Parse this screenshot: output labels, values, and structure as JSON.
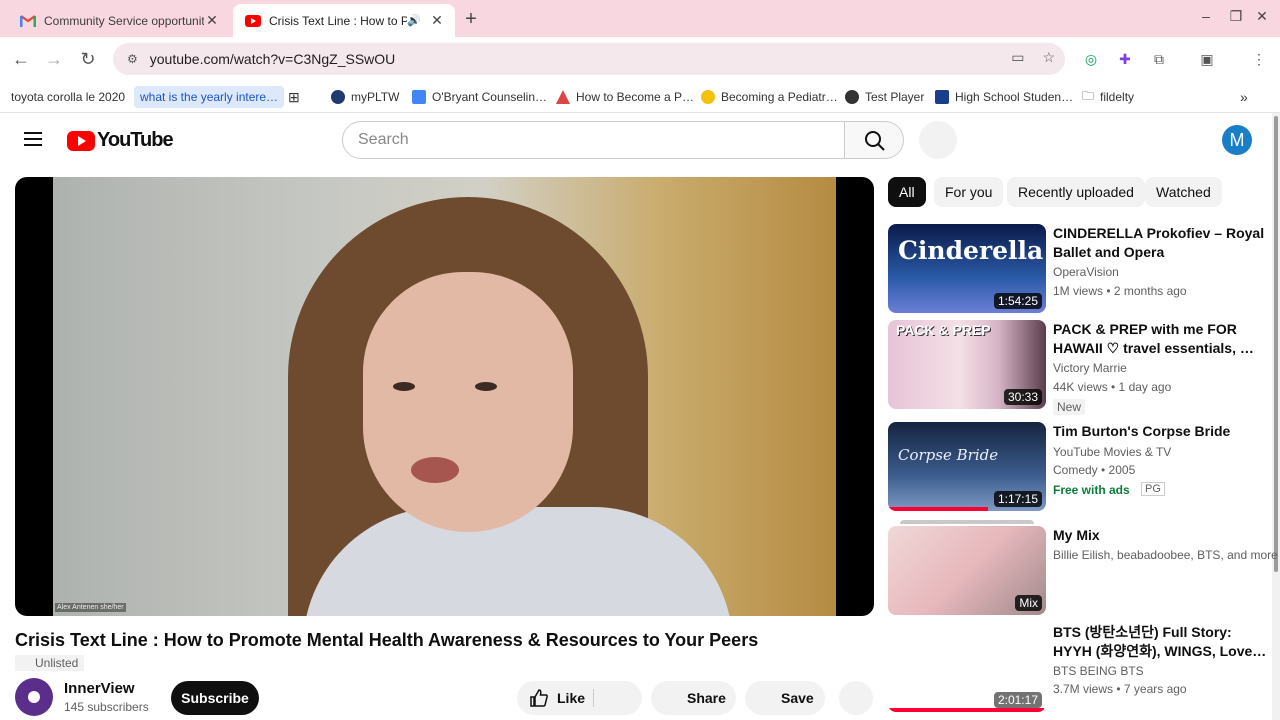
{
  "browser": {
    "tabs": [
      {
        "title": "Community Service opportunit…",
        "icon": "gmail-icon",
        "active": false
      },
      {
        "title": "Crisis Text Line : How to Pr…",
        "icon": "youtube-icon",
        "active": true
      }
    ],
    "url": "youtube.com/watch?v=C3NgZ_SSwOU",
    "bookmarks": [
      "toyota corolla le 2020",
      "what is the yearly intere…",
      "myPLTW",
      "O'Bryant Counselin…",
      "How to Become a P…",
      "Becoming a Pediatr…",
      "Test Player",
      "High School Studen…",
      "fildelty"
    ]
  },
  "youtube": {
    "logo_text": "YouTube",
    "search_placeholder": "Search",
    "avatar_letter": "M",
    "video": {
      "title": "Crisis Text Line : How to Promote Mental Health Awareness & Resources to Your Peers",
      "status": "Unlisted",
      "caption": "Alex Antenen she/her",
      "channel": "InnerView",
      "subscribers": "145 subscribers",
      "subscribe_label": "Subscribe",
      "like_label": "Like",
      "share_label": "Share",
      "save_label": "Save"
    },
    "chips": [
      "All",
      "For you",
      "Recently uploaded",
      "Watched"
    ],
    "recommendations": [
      {
        "title": "CINDERELLA Prokofiev – Royal Ballet and Opera",
        "channel": "OperaVision",
        "meta": "1M views • 2 months ago",
        "duration": "1:54:25",
        "thumb_text": "Cinderella"
      },
      {
        "title": "PACK & PREP with me FOR HAWAII ♡ travel essentials, …",
        "channel": "Victory Marrie",
        "meta": "44K views • 1 day ago",
        "duration": "30:33",
        "badge": "New",
        "thumb_text": "PACK & PREP"
      },
      {
        "title": "Tim Burton's Corpse Bride",
        "channel": "YouTube Movies & TV",
        "meta": "Comedy • 2005",
        "duration": "1:17:15",
        "free": "Free with ads",
        "rating": "PG",
        "thumb_text": "Corpse Bride"
      },
      {
        "title": "My Mix",
        "channel": "Billie Eilish, beabadoobee, BTS, and more",
        "duration": "Mix"
      },
      {
        "title": "BTS (방탄소년단) Full Story: HYYH (화양연화), WINGS, Love…",
        "channel": "BTS BEING BTS",
        "meta": "3.7M views • 7 years ago",
        "duration": "2:01:17"
      }
    ]
  },
  "colors": {
    "accent": "#ff0000",
    "avatar": "#1a7fc9",
    "tab_strip": "#f8d7e0"
  }
}
